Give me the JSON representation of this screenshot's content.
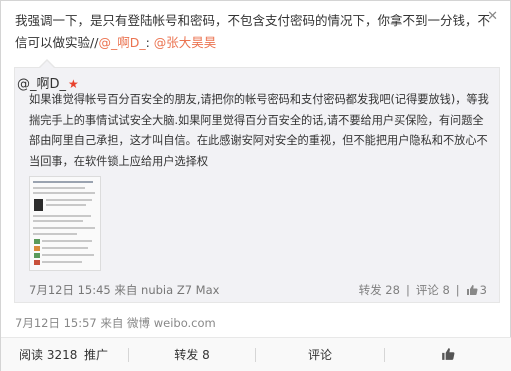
{
  "post": {
    "text_part1": "我强调一下，是只有登陆帐号和密码，不包含支付密码的情况下，你拿不到一分钱，不信可以做实验//",
    "mention1": "@_啊D_",
    "text_sep": ": ",
    "mention2": "@张大昊昊",
    "close_glyph": "✕"
  },
  "quote": {
    "author": "@_啊D_",
    "badge_glyph": "★",
    "text": "如果谁觉得帐号百分百安全的朋友,请把你的帐号密码和支付密码都发我吧(记得要放钱)，等我揣完手上的事情试试安全大脑.如果阿里觉得百分百安全的话,请不要给用户买保险，有问题全部由阿里自己承担，这才叫自信。在此感谢安阿对安全的重视，但不能把用户隐私和不放心不当回事，在软件锁上应给用户选择权",
    "meta": "7月12日 15:45 来自 nubia Z7 Max",
    "forward": "转发 28",
    "comment": "评论 8",
    "like_count": "3",
    "separator": "|"
  },
  "meta": "7月12日 15:57 来自 微博 weibo.com",
  "bar": {
    "read": "阅读 3218",
    "promote": "推广",
    "forward": "转发 8",
    "comment": "评论"
  },
  "colors": {
    "mention": "#eb7350",
    "badge": "#e8412c",
    "quote_bg": "#f2f2f5"
  },
  "icons": {
    "thumbnail": "screenshot-thumbnail-icon",
    "like": "thumbs-up-icon",
    "close": "close-icon"
  }
}
